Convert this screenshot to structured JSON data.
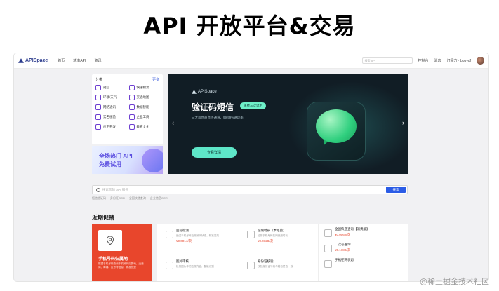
{
  "slide_title": "API 开放平台&交易",
  "nav": {
    "brand": "APISpace",
    "links": [
      "首页",
      "精准API",
      "资讯"
    ],
    "search_placeholder": "搜索 API",
    "right_links": [
      "控制台",
      "消息",
      "订阅方 · bopvdf"
    ]
  },
  "categories": {
    "title": "分类",
    "more": "更多",
    "items": [
      {
        "label": "短信"
      },
      {
        "label": "快递物流"
      },
      {
        "label": "环境/天气"
      },
      {
        "label": "交通地图"
      },
      {
        "label": "网络通讯"
      },
      {
        "label": "数据智能"
      },
      {
        "label": "实名核验"
      },
      {
        "label": "企业工商"
      },
      {
        "label": "应用开发"
      },
      {
        "label": "教育文化"
      }
    ]
  },
  "promo_side": {
    "line1": "全场热门 API",
    "line2": "免费试用"
  },
  "banner": {
    "brand": "APISpace",
    "title": "验证码短信",
    "tag": "免费三次试用",
    "subtitle": "三大运营商直连通道，99.99%送达率",
    "button": "查看详情",
    "prev": "‹",
    "next": "›"
  },
  "search": {
    "placeholder": "搜索您的 API 服务",
    "button": "搜索",
    "hot_links": [
      "短信验证码",
      "身份证OCR",
      "全国快递查询",
      "企业信息OCR"
    ]
  },
  "section_title": "近期促销",
  "featured": {
    "title": "手机号码归属地",
    "desc": "根据手机号码查询手机号码归属地、运营商、邮编、区号等信息，精准快速"
  },
  "deals": [
    {
      "name": "空号检测",
      "desc": "通过手机号码检测号码状态，精准高效",
      "price": "¥0.0014/次"
    },
    {
      "name": "在网时长（本毛菌）",
      "desc": "检测手机号码在网使用时长",
      "price": "¥0.0128/次"
    },
    {
      "name": "全国快递查询【消费版】",
      "desc": "",
      "price": "¥0.0062/次"
    },
    {
      "name": "二次号查询",
      "desc": "",
      "price": "¥0.1780/次"
    },
    {
      "name": "手机在网状态",
      "desc": "",
      "price": ""
    },
    {
      "name": "图片审核",
      "desc": "检测图片中的违规内容，智能识别",
      "price": ""
    },
    {
      "name": "身份证核验",
      "desc": "校验身份证号码与姓名是否一致",
      "price": ""
    }
  ],
  "watermark": "@稀土掘金技术社区"
}
